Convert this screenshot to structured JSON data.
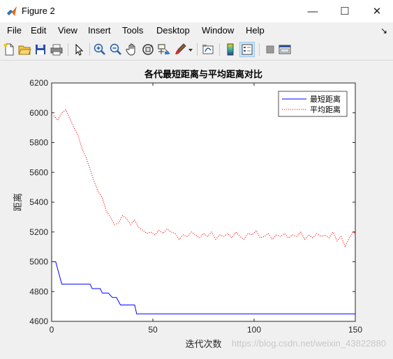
{
  "window": {
    "title": "Figure 2",
    "controls": {
      "minimize": "—",
      "maximize": "☐",
      "close": "✕"
    }
  },
  "menu": {
    "items": [
      "File",
      "Edit",
      "View",
      "Insert",
      "Tools",
      "Desktop",
      "Window",
      "Help"
    ],
    "overflow": "↘"
  },
  "toolbar": {
    "icons": [
      "new-figure-icon",
      "open-file-icon",
      "save-icon",
      "print-icon",
      "select-cursor-icon",
      "zoom-in-icon",
      "zoom-out-icon",
      "pan-hand-icon",
      "rotate-3d-icon",
      "data-cursor-icon",
      "brush-icon",
      "link-plot-icon",
      "colorbar-icon",
      "legend-icon",
      "hide-plot-tools-icon",
      "show-plot-tools-icon"
    ]
  },
  "chart_data": {
    "type": "line",
    "title": "各代最短距离与平均距离对比",
    "xlabel": "迭代次数",
    "ylabel": "距离",
    "xlim": [
      0,
      150
    ],
    "ylim": [
      4600,
      6200
    ],
    "xticks": [
      0,
      50,
      100,
      150
    ],
    "yticks": [
      4600,
      4800,
      5000,
      5200,
      5400,
      5600,
      5800,
      6000,
      6200
    ],
    "legend_position": "top-right",
    "grid": false,
    "series": [
      {
        "name": "最短距离",
        "color": "#0000ff",
        "style": "solid",
        "step": true,
        "x": [
          1,
          2,
          3,
          4,
          5,
          19,
          20,
          24,
          25,
          28,
          30,
          32,
          34,
          41,
          42,
          150
        ],
        "y": [
          5000,
          5000,
          4950,
          4900,
          4850,
          4850,
          4820,
          4820,
          4790,
          4790,
          4760,
          4760,
          4710,
          4710,
          4650,
          4650
        ]
      },
      {
        "name": "平均距离",
        "color": "#ff0000",
        "style": "dotted",
        "x": [
          1,
          3,
          5,
          7,
          9,
          11,
          13,
          15,
          17,
          19,
          21,
          23,
          25,
          27,
          29,
          31,
          33,
          35,
          37,
          39,
          41,
          43,
          45,
          47,
          49,
          51,
          53,
          55,
          57,
          59,
          61,
          63,
          65,
          67,
          69,
          71,
          73,
          75,
          77,
          79,
          81,
          83,
          85,
          87,
          89,
          91,
          93,
          95,
          97,
          99,
          101,
          103,
          105,
          107,
          109,
          111,
          113,
          115,
          117,
          119,
          121,
          123,
          125,
          127,
          129,
          131,
          133,
          135,
          137,
          139,
          141,
          143,
          145,
          147,
          149,
          150
        ],
        "y": [
          5980,
          5950,
          6000,
          6020,
          5960,
          5900,
          5850,
          5760,
          5700,
          5620,
          5540,
          5470,
          5430,
          5340,
          5300,
          5250,
          5260,
          5310,
          5290,
          5250,
          5280,
          5230,
          5210,
          5190,
          5200,
          5180,
          5210,
          5190,
          5220,
          5200,
          5190,
          5150,
          5180,
          5170,
          5200,
          5180,
          5160,
          5190,
          5170,
          5200,
          5150,
          5180,
          5170,
          5190,
          5160,
          5200,
          5170,
          5150,
          5190,
          5180,
          5210,
          5160,
          5170,
          5190,
          5150,
          5180,
          5170,
          5190,
          5160,
          5180,
          5170,
          5200,
          5150,
          5180,
          5160,
          5190,
          5170,
          5180,
          5160,
          5200,
          5140,
          5170,
          5100,
          5160,
          5200,
          5190
        ]
      }
    ]
  },
  "watermark": {
    "text": "https://blog.csdn.net/weixin_43822880"
  }
}
